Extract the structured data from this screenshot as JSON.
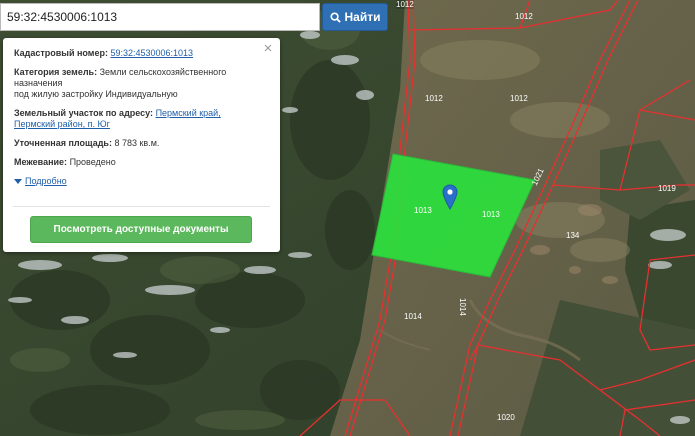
{
  "search": {
    "value": "59:32:4530006:1013",
    "button_label": "Найти"
  },
  "info": {
    "cadastral_label": "Кадастровый номер:",
    "cadastral_value": "59:32:4530006:1013",
    "category_label": "Категория земель:",
    "category_value_1": "Земли сельскохозяйственного назначения",
    "category_value_2": "под жилую застройку Индивидуальную",
    "address_label": "Земельный участок по адресу:",
    "address_part1": "Пермский край,",
    "address_part2": "Пермский район, п. Юг",
    "area_label": "Уточненная площадь:",
    "area_value": "8 783 кв.м.",
    "survey_label": "Межевание:",
    "survey_value": "Проведено",
    "more_link": "Подробно",
    "close_symbol": "×",
    "docs_button_label": "Посмотреть доступные документы"
  },
  "map": {
    "parcel_labels": {
      "p1012a": "1012",
      "p1012b": "1012",
      "p1012c": "1012",
      "p1012d": "1012",
      "p1013a": "1013",
      "p1013b": "1013",
      "p1021": "1021",
      "p1019": "1019",
      "p134": "134",
      "p1014a": "1014",
      "p1014b": "1014",
      "p1020": "1020"
    }
  },
  "colors": {
    "selected_parcel": "#2be03c",
    "boundary": "#e63030",
    "marker": "#2a6fc9",
    "search_button": "#2f6fb4",
    "docs_button": "#5cb85c"
  },
  "icons": {
    "search": "search-icon",
    "marker": "map-marker-icon",
    "close": "close-icon",
    "expand": "triangle-down-icon"
  }
}
